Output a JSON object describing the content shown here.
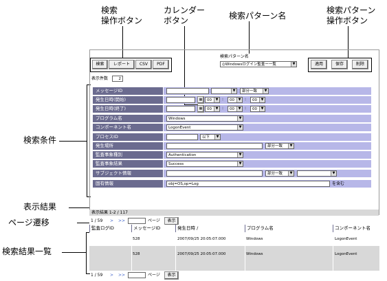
{
  "callouts": {
    "search_buttons": [
      "検索",
      "操作ボタン"
    ],
    "calendar_button": [
      "カレンダー",
      "ボタン"
    ],
    "pattern_name": "検索パターン名",
    "pattern_buttons": [
      "検索パターン",
      "操作ボタン"
    ],
    "search_conditions": "検索条件",
    "display_result": "表示結果",
    "page_nav": "ページ遷移",
    "result_list": "検索結果一覧"
  },
  "toolbar": {
    "search": "検索",
    "report": "レポート",
    "csv": "CSV",
    "pdf": "PDF"
  },
  "pattern": {
    "label": "検索パターン名",
    "selected": "◎Windowsログイン監査ー一覧",
    "apply": "適用",
    "save": "保存",
    "delete": "削除"
  },
  "display_count": {
    "label": "表示件数",
    "value": "2"
  },
  "conditions": {
    "message_id": {
      "label": "メッセージID",
      "match": "部分一致"
    },
    "start_time": {
      "label": "発生日時(開始)",
      "hh": "00",
      "mm": "00",
      "ss": "00"
    },
    "end_time": {
      "label": "発生日時(終了)",
      "hh": "00",
      "mm": "00",
      "ss": "00"
    },
    "program": {
      "label": "プログラム名",
      "value": "Windows"
    },
    "component": {
      "label": "コンポーネント名",
      "value": "LogonEvent"
    },
    "process_id": {
      "label": "プロセスID",
      "op": "以下"
    },
    "location": {
      "label": "発生場所",
      "match": "部分一致"
    },
    "audit_type": {
      "label": "監査事象種別",
      "value": "Authentication"
    },
    "audit_result": {
      "label": "監査事象結果",
      "value": "Success"
    },
    "subject": {
      "label": "サブジェクト情報",
      "match": "部分一致"
    },
    "unique": {
      "label": "固有情報",
      "value": "obj=OS,op=Log",
      "suffix": "を含む"
    }
  },
  "result_summary": "表示結果 1-2 / 117",
  "pager": {
    "text": "1 / 59",
    "next": ">",
    "last": ">>",
    "page_label": "ページ",
    "show": "表示"
  },
  "table": {
    "headers": [
      "監査ログID",
      "メッセージID",
      "発生日時 /",
      "プログラム名",
      "コンポーネント名"
    ],
    "rows": [
      [
        "",
        "528",
        "2007/09/25 20:05:07.000",
        "Windows",
        "LogonEvent"
      ],
      [
        "",
        "528",
        "2007/09/25 20:05:07.000",
        "Windows",
        "LogonEvent"
      ]
    ]
  },
  "colors": {
    "label_bg": "#6b6b8f",
    "value_bg": "#b7b7e8",
    "header_bg": "#6b6b8f",
    "row_alt": "#d8d8d8"
  }
}
